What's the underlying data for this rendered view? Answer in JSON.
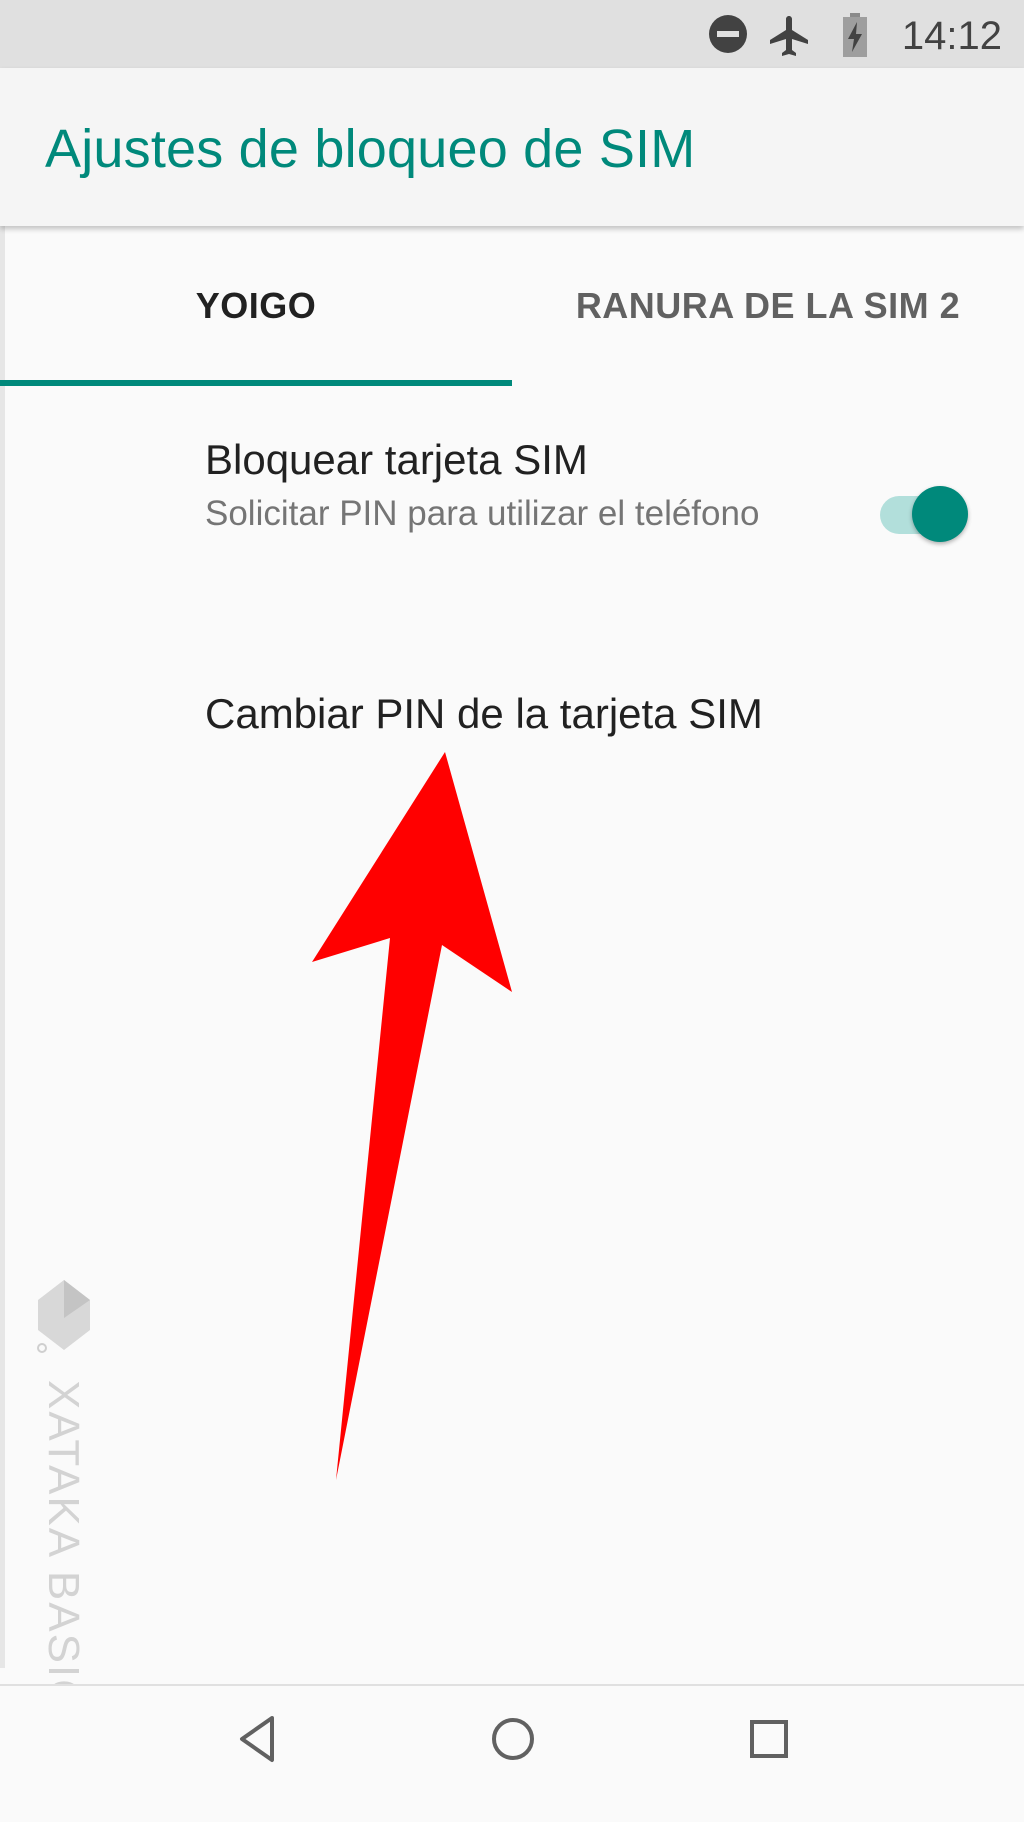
{
  "status_bar": {
    "time": "14:12",
    "icons": [
      "do-not-disturb-icon",
      "airplane-mode-icon",
      "battery-charging-icon"
    ]
  },
  "app_bar": {
    "title": "Ajustes de bloqueo de SIM"
  },
  "tabs": [
    {
      "label": "YOIGO",
      "selected": true
    },
    {
      "label": "RANURA DE LA SIM 2",
      "selected": false
    }
  ],
  "preferences": {
    "lock_sim": {
      "title": "Bloquear tarjeta SIM",
      "summary": "Solicitar PIN para utilizar el teléfono",
      "enabled": true
    },
    "change_pin": {
      "title": "Cambiar PIN de la tarjeta SIM"
    }
  },
  "watermark": {
    "text": "XATAKA BASICS"
  },
  "nav_bar": {
    "icons": [
      "back-icon",
      "home-icon",
      "recents-icon"
    ]
  },
  "colors": {
    "accent": "#00897b",
    "switch_track": "#b2dfdb",
    "arrow": "#ff0000"
  }
}
